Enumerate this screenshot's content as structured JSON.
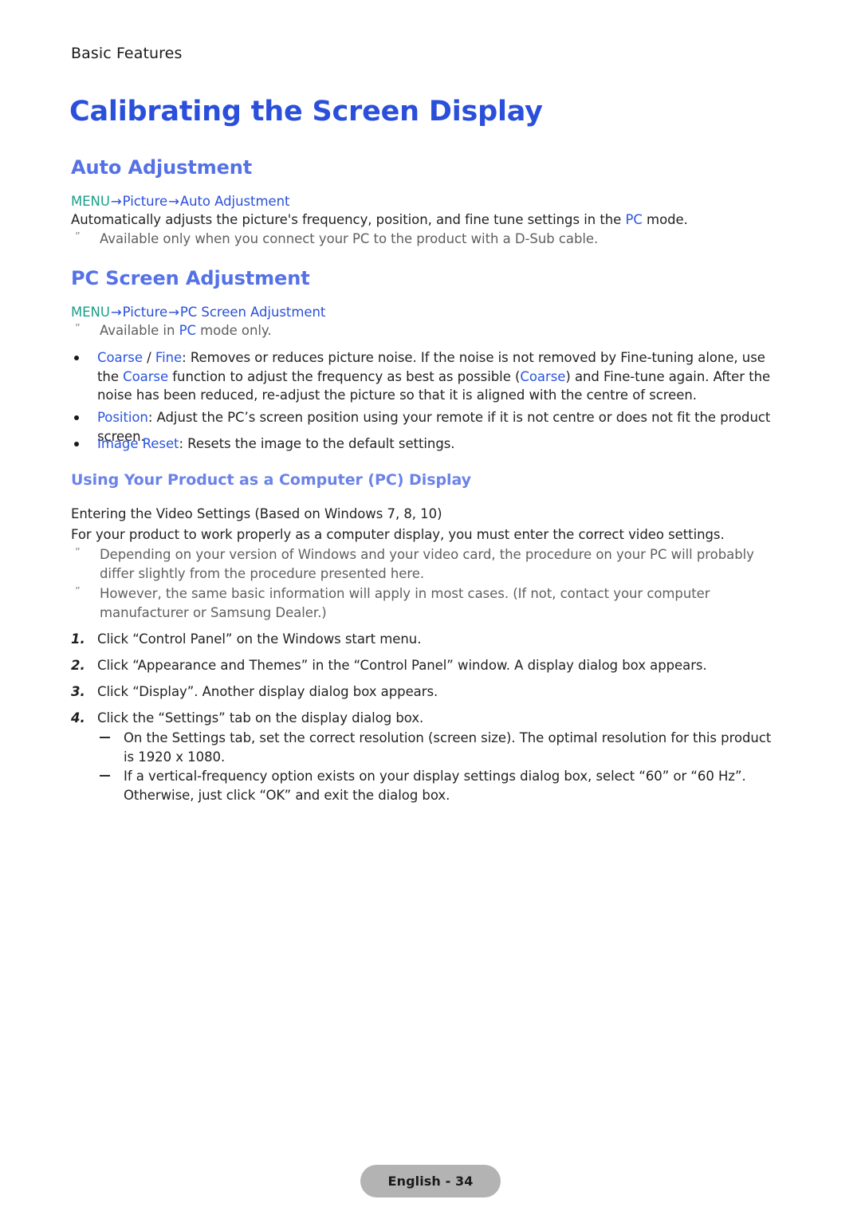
{
  "page": {
    "running_header": "Basic Features",
    "chapter_title": "Calibrating the Screen Display",
    "footer_badge": "English - 34"
  },
  "colors": {
    "chapter_title": "#2a4fdb",
    "section_heading": "#5571e6",
    "sub_heading": "#6b82e8",
    "menu_root": "#1a9e88",
    "menu_path": "#2a4fdb",
    "inline_keyword": "#2a55e0",
    "body_text": "#231f20",
    "note_text": "#5f5f5f",
    "badge_background": "#b3b3b3"
  },
  "auto_adjustment": {
    "heading": "Auto Adjustment",
    "menu_path": {
      "root": "MENU",
      "arrow": "→",
      "level2": "Picture",
      "level3": "Auto Adjustment"
    },
    "description_before": "Automatically adjusts the picture's frequency, position, and fine tune settings in the ",
    "description_keyword": "PC",
    "description_after": " mode.",
    "note_marker": "”",
    "note": "Available only when you connect your PC to the product with a D-Sub cable."
  },
  "pc_screen_adjustment": {
    "heading": "PC Screen Adjustment",
    "menu_path": {
      "root": "MENU",
      "arrow": "→",
      "level2": "Picture",
      "level3": "PC Screen Adjustment"
    },
    "note_marker": "”",
    "note_before": "Available in ",
    "note_keyword": "PC",
    "note_after": " mode only.",
    "bullets": [
      {
        "term_a": "Coarse",
        "separator": " / ",
        "term_b": "Fine",
        "text_1": ": Removes or reduces picture noise. If the noise is not removed by Fine-tuning alone, use the ",
        "term_c": "Coarse",
        "text_2": " function to adjust the frequency as best as possible (",
        "term_d": "Coarse",
        "text_3": ") and Fine-tune again. After the noise has been reduced, re-adjust the picture so that it is aligned with the centre of screen."
      },
      {
        "term": "Position",
        "text": ": Adjust the PC’s screen position using your remote if it is not centre or does not fit the product screen."
      },
      {
        "term": "Image Reset",
        "text": ": Resets the image to the default settings."
      }
    ]
  },
  "using_product": {
    "heading": "Using Your Product as a Computer (PC) Display",
    "line_1": "Entering the Video Settings (Based on Windows 7, 8, 10)",
    "line_2": "For your product to work properly as a computer display, you must enter the correct video settings.",
    "note_marker": "”",
    "notes": [
      "Depending on your version of Windows and your video card, the procedure on your PC will probably differ slightly from the procedure presented here.",
      "However, the same basic information will apply in most cases. (If not, contact your computer manufacturer or Samsung Dealer.)"
    ],
    "steps": [
      {
        "num": "1.",
        "text": "Click “Control Panel” on the Windows start menu."
      },
      {
        "num": "2.",
        "text": "Click “Appearance and Themes” in the “Control Panel” window. A display dialog box appears."
      },
      {
        "num": "3.",
        "text": "Click “Display”. Another display dialog box appears."
      },
      {
        "num": "4.",
        "text": "Click the “Settings” tab on the display dialog box."
      }
    ],
    "substeps": [
      "On the Settings tab, set the correct resolution (screen size). The optimal resolution for this product is 1920 x 1080.",
      "If a vertical-frequency option exists on your display settings dialog box, select “60” or “60 Hz”. Otherwise, just click “OK” and exit the dialog box."
    ]
  }
}
